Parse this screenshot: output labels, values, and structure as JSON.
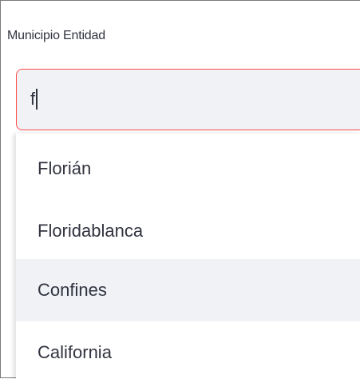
{
  "field": {
    "label": "Municipio Entidad",
    "value": "f"
  },
  "dropdown": {
    "options": [
      {
        "label": "Florián"
      },
      {
        "label": "Floridablanca"
      },
      {
        "label": "Confines"
      },
      {
        "label": "California"
      }
    ],
    "highlighted_option": "Confines"
  },
  "colors": {
    "focus_border": "#ff4b4b",
    "input_background": "#f0f2f6",
    "text": "#31333f",
    "highlight_background": "#f0f2f6"
  }
}
